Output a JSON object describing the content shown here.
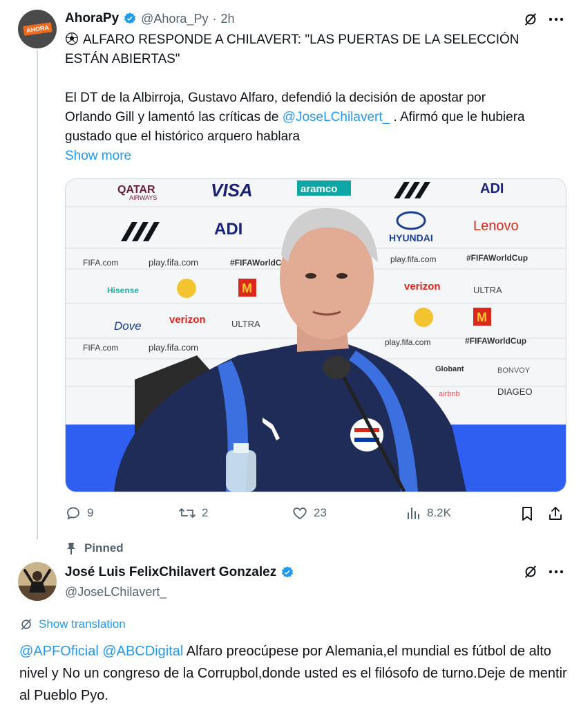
{
  "tweet1": {
    "avatar_text": "AHORA",
    "display_name": "AhoraPy",
    "handle": "@Ahora_Py",
    "separator": "·",
    "time": "2h",
    "headline": "ALFARO RESPONDE A CHILAVERT: \"LAS PUERTAS DE LA SELECCIÓN ESTÁN ABIERTAS\"",
    "body_part1": "El DT de la Albirroja, Gustavo Alfaro, defendió la decisión de apostar por Orlando Gill y lamentó las críticas de",
    "mention": "@JoseLChilavert_",
    "body_part2": ". Afirmó que le hubiera gustado que el histórico arquero hablara",
    "show_more": "Show more",
    "media": {
      "backdrop_logos": [
        "QATAR",
        "AIRWAYS",
        "VISA",
        "aramco",
        "ADI",
        "HYUNDAI",
        "Lenovo",
        "FIFA.com",
        "play.fifa.com",
        "#FIFAWorldCup",
        "Hisense",
        "verizon",
        "ULTRA",
        "Dove",
        "Globant",
        "BONVOY",
        "DIAGEO",
        "airbnb"
      ]
    },
    "actions": {
      "replies": "9",
      "reposts": "2",
      "likes": "23",
      "views": "8.2K"
    }
  },
  "tweet2": {
    "pinned_label": "Pinned",
    "display_name": "José Luis FelixChilavert Gonzalez",
    "handle": "@JoseLChilavert_",
    "show_translation": "Show translation",
    "mention1": "@APFOficial",
    "mention2": "@ABCDigital",
    "body": "Alfaro preocúpese por Alemania,el mundial es fútbol de alto nivel y No un congreso de la Corrupbol,donde usted es el filósofo de turno.Deje de mentir al Pueblo Pyo."
  },
  "colors": {
    "verified": "#1d9bf0",
    "link": "#1d9bf0",
    "muted": "#536471"
  },
  "icons": [
    "soccer-ball-icon",
    "verified-badge-icon",
    "grok-icon",
    "more-icon",
    "reply-icon",
    "repost-icon",
    "like-icon",
    "views-icon",
    "bookmark-icon",
    "share-icon",
    "pin-icon",
    "translate-icon"
  ]
}
